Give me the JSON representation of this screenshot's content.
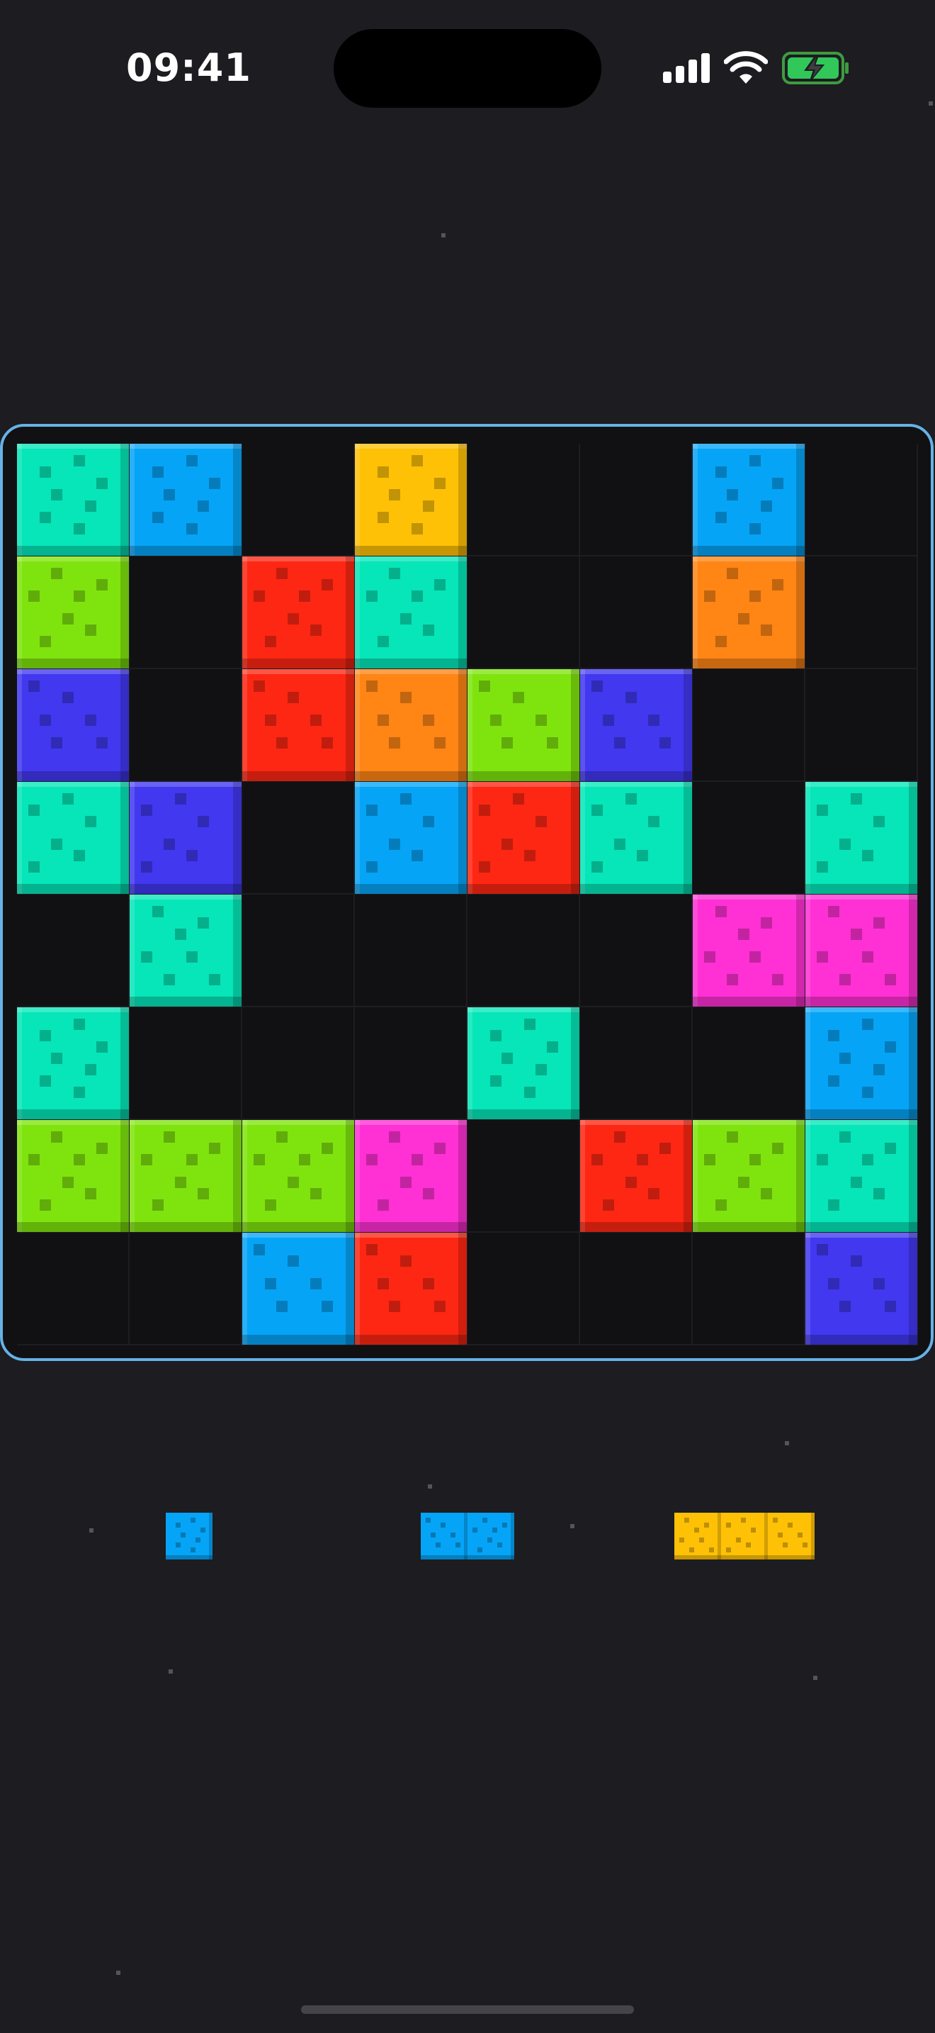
{
  "status_bar": {
    "time": "09:41",
    "battery_charging": true
  },
  "colors": {
    "teal": "#06e6b8",
    "blue": "#06a4f6",
    "yellow": "#ffc106",
    "green": "#7fe40e",
    "red": "#fe2713",
    "orange": "#ff8515",
    "indigo": "#4138f0",
    "magenta": "#ff30d4",
    "board_border": "#66b2e6",
    "board_bg": "#111114",
    "background": "#1c1c21"
  },
  "board": {
    "rows": 8,
    "cols": 8,
    "cells": [
      [
        "teal",
        "blue",
        null,
        "yellow",
        null,
        null,
        "blue",
        null
      ],
      [
        "green",
        null,
        "red",
        "teal",
        null,
        null,
        "orange",
        null
      ],
      [
        "indigo",
        null,
        "red",
        "orange",
        "green",
        "indigo",
        null,
        null
      ],
      [
        "teal",
        "indigo",
        null,
        "blue",
        "red",
        "teal",
        null,
        "teal"
      ],
      [
        null,
        "teal",
        null,
        null,
        null,
        null,
        "magenta",
        "magenta"
      ],
      [
        "teal",
        null,
        null,
        null,
        "teal",
        null,
        null,
        "blue"
      ],
      [
        "green",
        "green",
        "green",
        "magenta",
        null,
        "red",
        "green",
        "teal"
      ],
      [
        null,
        null,
        "blue",
        "red",
        null,
        null,
        null,
        "indigo"
      ]
    ]
  },
  "tray": {
    "pieces": [
      {
        "color": "blue",
        "length": 1
      },
      {
        "color": "blue",
        "length": 2
      },
      {
        "color": "yellow",
        "length": 3
      }
    ]
  }
}
